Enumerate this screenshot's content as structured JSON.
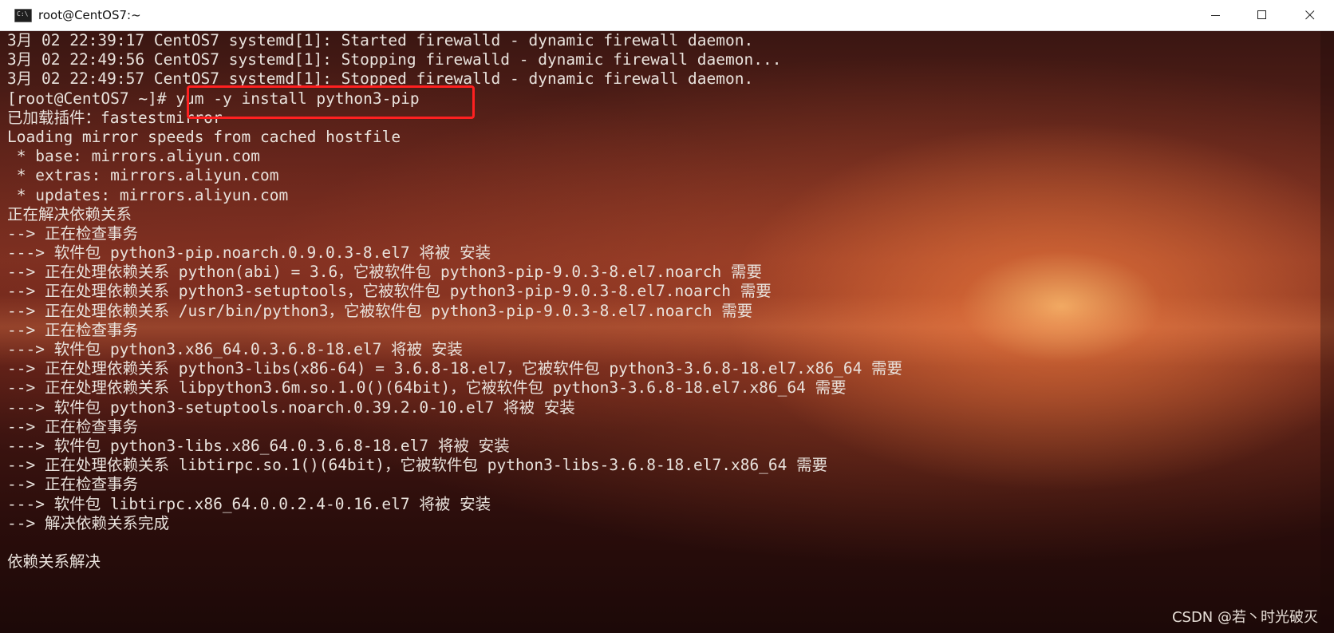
{
  "window": {
    "title": "root@CentOS7:~",
    "icon": "cmd-icon",
    "controls": {
      "minimize": "minimize-icon",
      "maximize": "maximize-icon",
      "close": "close-icon"
    }
  },
  "terminal": {
    "lines": [
      "3月 02 22:39:17 CentOS7 systemd[1]: Started firewalld - dynamic firewall daemon.",
      "3月 02 22:49:56 CentOS7 systemd[1]: Stopping firewalld - dynamic firewall daemon...",
      "3月 02 22:49:57 CentOS7 systemd[1]: Stopped firewalld - dynamic firewall daemon.",
      "[root@CentOS7 ~]# yum -y install python3-pip",
      "已加载插件：fastestmirror",
      "Loading mirror speeds from cached hostfile",
      " * base: mirrors.aliyun.com",
      " * extras: mirrors.aliyun.com",
      " * updates: mirrors.aliyun.com",
      "正在解决依赖关系",
      "--> 正在检查事务",
      "---> 软件包 python3-pip.noarch.0.9.0.3-8.el7 将被 安装",
      "--> 正在处理依赖关系 python(abi) = 3.6，它被软件包 python3-pip-9.0.3-8.el7.noarch 需要",
      "--> 正在处理依赖关系 python3-setuptools，它被软件包 python3-pip-9.0.3-8.el7.noarch 需要",
      "--> 正在处理依赖关系 /usr/bin/python3，它被软件包 python3-pip-9.0.3-8.el7.noarch 需要",
      "--> 正在检查事务",
      "---> 软件包 python3.x86_64.0.3.6.8-18.el7 将被 安装",
      "--> 正在处理依赖关系 python3-libs(x86-64) = 3.6.8-18.el7，它被软件包 python3-3.6.8-18.el7.x86_64 需要",
      "--> 正在处理依赖关系 libpython3.6m.so.1.0()(64bit)，它被软件包 python3-3.6.8-18.el7.x86_64 需要",
      "---> 软件包 python3-setuptools.noarch.0.39.2.0-10.el7 将被 安装",
      "--> 正在检查事务",
      "---> 软件包 python3-libs.x86_64.0.3.6.8-18.el7 将被 安装",
      "--> 正在处理依赖关系 libtirpc.so.1()(64bit)，它被软件包 python3-libs-3.6.8-18.el7.x86_64 需要",
      "--> 正在检查事务",
      "---> 软件包 libtirpc.x86_64.0.0.2.4-0.16.el7 将被 安装",
      "--> 解决依赖关系完成",
      "",
      "依赖关系解决"
    ],
    "highlighted_command": "yum -y install python3-pip",
    "highlight_color": "#ff2020"
  },
  "watermark": "CSDN @若丶时光破灭"
}
